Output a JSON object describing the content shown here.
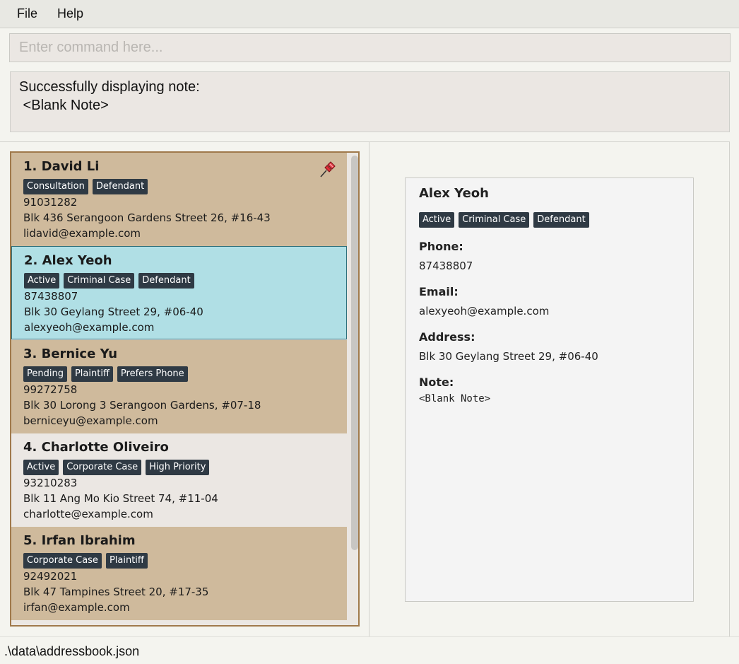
{
  "menu": {
    "file": "File",
    "help": "Help"
  },
  "command": {
    "placeholder": "Enter command here...",
    "value": ""
  },
  "result": {
    "text": "Successfully displaying note:\n <Blank Note>"
  },
  "persons": [
    {
      "index_name": "1. David Li",
      "tags": [
        "Consultation",
        "Defendant"
      ],
      "phone": "91031282",
      "address": "Blk 436 Serangoon Gardens Street 26, #16-43",
      "email": "lidavid@example.com",
      "pinned": true,
      "style": "tan"
    },
    {
      "index_name": "2. Alex Yeoh",
      "tags": [
        "Active",
        "Criminal Case",
        "Defendant"
      ],
      "phone": "87438807",
      "address": "Blk 30 Geylang Street 29, #06-40",
      "email": "alexyeoh@example.com",
      "pinned": false,
      "style": "selected"
    },
    {
      "index_name": "3. Bernice Yu",
      "tags": [
        "Pending",
        "Plaintiff",
        "Prefers Phone"
      ],
      "phone": "99272758",
      "address": "Blk 30 Lorong 3 Serangoon Gardens, #07-18",
      "email": "berniceyu@example.com",
      "pinned": false,
      "style": "tan"
    },
    {
      "index_name": "4. Charlotte Oliveiro",
      "tags": [
        "Active",
        "Corporate Case",
        "High Priority"
      ],
      "phone": "93210283",
      "address": "Blk 11 Ang Mo Kio Street 74, #11-04",
      "email": "charlotte@example.com",
      "pinned": false,
      "style": "light"
    },
    {
      "index_name": "5. Irfan Ibrahim",
      "tags": [
        "Corporate Case",
        "Plaintiff"
      ],
      "phone": "92492021",
      "address": "Blk 47 Tampines Street 20, #17-35",
      "email": "irfan@example.com",
      "pinned": false,
      "style": "tan"
    }
  ],
  "detail": {
    "name": "Alex Yeoh",
    "tags": [
      "Active",
      "Criminal Case",
      "Defendant"
    ],
    "phone_label": "Phone:",
    "phone": "87438807",
    "email_label": "Email:",
    "email": "alexyeoh@example.com",
    "address_label": "Address:",
    "address": "Blk 30 Geylang Street 29, #06-40",
    "note_label": "Note:",
    "note": "<Blank Note>"
  },
  "status": {
    "path": ".\\data\\addressbook.json"
  },
  "icons": {
    "pin": "pushpin-icon"
  },
  "colors": {
    "card_tan": "#cfba9c",
    "card_selected": "#b0dfe5",
    "card_light": "#ebe7e3",
    "tag_bg": "#2f3a44",
    "list_border": "#a07a4c"
  }
}
